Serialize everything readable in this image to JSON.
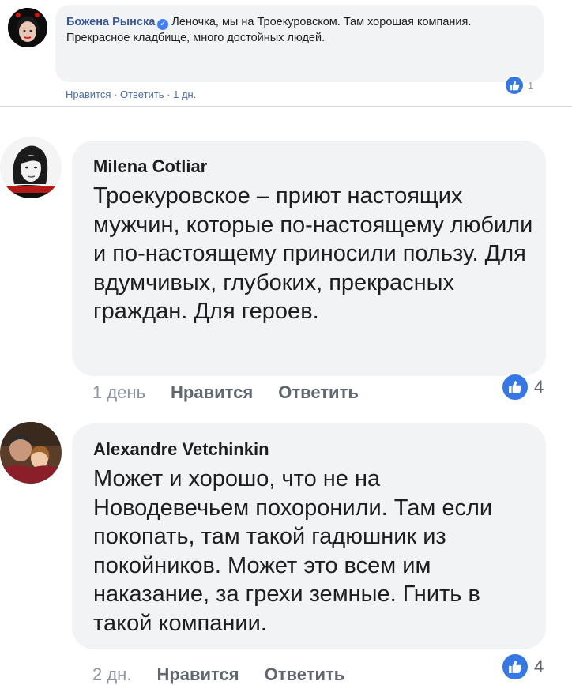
{
  "comments": [
    {
      "author": "Божена Рынска",
      "text": "Леночка, мы на Троекуровском. Там хорошая компания. Прекрасное кладбище, много достойных людей.",
      "like_label": "Нравится",
      "reply_label": "Ответить",
      "time": "1 дн.",
      "reaction_count": "1",
      "verified": true
    },
    {
      "author": "Milena Cotliar",
      "text": "Троекуровское – приют настоящих мужчин, которые по-настоящему любили и по-настоящему приносили пользу. Для вдумчивых, глубоких, прекрасных граждан. Для героев.",
      "time": "1 день",
      "like_label": "Нравится",
      "reply_label": "Ответить",
      "reaction_count": "4"
    },
    {
      "author": "Alexandre Vetchinkin",
      "text": "Может и хорошо, что не на Новодевечьем похоронили. Там если покопать, там такой гадюшник из покойников. Может это всем им наказание, за грехи земные. Гнить в такой компании.",
      "time": "2 дн.",
      "like_label": "Нравится",
      "reply_label": "Ответить",
      "reaction_count": "4"
    }
  ],
  "colors": {
    "bubble": "#f2f3f5",
    "link_blue": "#385898",
    "like_blue": "#3578e5"
  }
}
